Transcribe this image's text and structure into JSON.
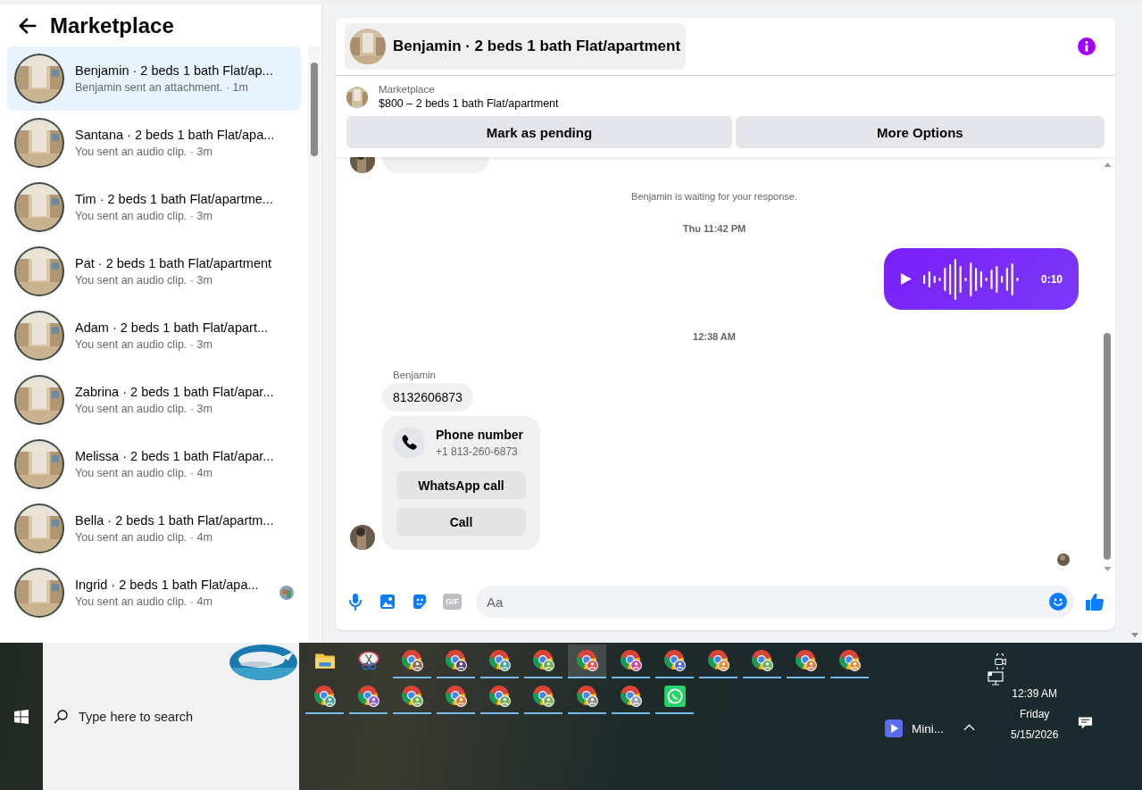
{
  "sidebar": {
    "title": "Marketplace",
    "conversations": [
      {
        "name_line": "Benjamin · 2 beds 1 bath Flat/ap...",
        "preview": "Benjamin sent an attachment. · 1m",
        "selected": true,
        "seen": false
      },
      {
        "name_line": "Santana · 2 beds 1 bath Flat/apa...",
        "preview": "You sent an audio clip. · 3m",
        "selected": false,
        "seen": false
      },
      {
        "name_line": "Tim · 2 beds 1 bath Flat/apartme...",
        "preview": "You sent an audio clip. · 3m",
        "selected": false,
        "seen": false
      },
      {
        "name_line": "Pat · 2 beds 1 bath Flat/apartment",
        "preview": "You sent an audio clip. · 3m",
        "selected": false,
        "seen": false
      },
      {
        "name_line": "Adam · 2 beds 1 bath Flat/apart...",
        "preview": "You sent an audio clip. · 3m",
        "selected": false,
        "seen": false
      },
      {
        "name_line": "Zabrina · 2 beds 1 bath Flat/apar...",
        "preview": "You sent an audio clip. · 3m",
        "selected": false,
        "seen": false
      },
      {
        "name_line": "Melissa · 2 beds 1 bath Flat/apar...",
        "preview": "You sent an audio clip. · 4m",
        "selected": false,
        "seen": false
      },
      {
        "name_line": "Bella · 2 beds 1 bath Flat/apartm...",
        "preview": "You sent an audio clip. · 4m",
        "selected": false,
        "seen": false
      },
      {
        "name_line": "Ingrid · 2 beds 1 bath Flat/apa...",
        "preview": "You sent an audio clip. · 4m",
        "selected": false,
        "seen": true
      }
    ]
  },
  "chat": {
    "title": "Benjamin · 2 beds 1 bath Flat/apartment",
    "listing": {
      "label": "Marketplace",
      "price_line": "$800 – 2 beds 1 bath Flat/apartment"
    },
    "actions": [
      "Mark as pending",
      "More Options"
    ],
    "messages": [
      {
        "kind": "notice",
        "text": "Benjamin is waiting for your response."
      },
      {
        "kind": "time",
        "text": "Thu 11:42 PM"
      },
      {
        "kind": "audio",
        "duration": "0:10"
      },
      {
        "kind": "time",
        "text": "12:38 AM"
      },
      {
        "kind": "sender",
        "text": "Benjamin"
      },
      {
        "kind": "text",
        "text": "8132606873"
      },
      {
        "kind": "contact",
        "title": "Phone number",
        "number": "+1 813-260-6873",
        "buttons": [
          "WhatsApp call",
          "Call"
        ]
      }
    ],
    "composer": {
      "placeholder": "Aa",
      "gif_label": "GIF"
    }
  },
  "taskbar": {
    "search_placeholder": "Type here to search",
    "apps": [
      {
        "kind": "folder",
        "running": false,
        "active": false
      },
      {
        "kind": "snip",
        "running": false,
        "active": false
      },
      {
        "kind": "chrome",
        "running": true,
        "active": false,
        "color": "#8a6d5a"
      },
      {
        "kind": "chrome",
        "running": true,
        "active": false,
        "color": "#5a3d7a"
      },
      {
        "kind": "chrome",
        "running": true,
        "active": false,
        "color": "#4aa3a0"
      },
      {
        "kind": "chrome",
        "running": true,
        "active": false,
        "color": "#6ab04c"
      },
      {
        "kind": "chrome",
        "running": true,
        "active": true,
        "color": "#e05050"
      },
      {
        "kind": "chrome",
        "running": true,
        "active": false,
        "color": "#d04a9a"
      },
      {
        "kind": "chrome",
        "running": true,
        "active": false,
        "color": "#4a6ad0"
      },
      {
        "kind": "chrome",
        "running": true,
        "active": false,
        "color": "#e08a3a"
      },
      {
        "kind": "chrome",
        "running": true,
        "active": false,
        "color": "#6ab04c"
      },
      {
        "kind": "chrome",
        "running": true,
        "active": false,
        "color": "#e07a3a"
      },
      {
        "kind": "chrome",
        "running": true,
        "active": false,
        "color": "#e0903a"
      },
      {
        "kind": "chrome",
        "running": true,
        "active": false,
        "color": "#4aa3a0"
      },
      {
        "kind": "chrome",
        "running": true,
        "active": false,
        "color": "#8a5ad0"
      },
      {
        "kind": "chrome",
        "running": true,
        "active": false,
        "color": "#6ab04c"
      },
      {
        "kind": "chrome",
        "running": true,
        "active": false,
        "color": "#e07a3a"
      },
      {
        "kind": "chrome",
        "running": true,
        "active": false,
        "color": "#6ab04c"
      },
      {
        "kind": "chrome",
        "running": true,
        "active": false,
        "color": "#7ab05c"
      },
      {
        "kind": "chrome",
        "running": true,
        "active": false,
        "color": "#8a8a8a"
      },
      {
        "kind": "chrome",
        "running": true,
        "active": false,
        "color": "#9aa0b0"
      },
      {
        "kind": "whatsapp",
        "running": true,
        "active": false
      }
    ],
    "tray": {
      "app_label": "Mini...",
      "time": "12:39 AM",
      "day": "Friday",
      "date": "5/15/2026"
    }
  }
}
